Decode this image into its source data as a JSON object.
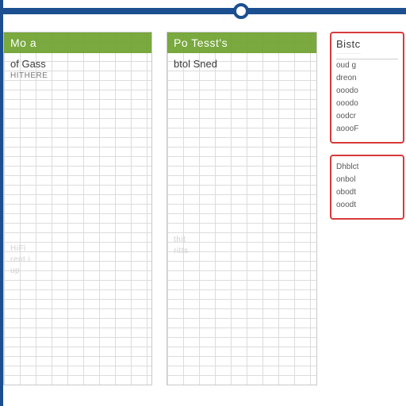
{
  "colors": {
    "bar": "#1b4f90",
    "header": "#6fa22f",
    "panel_border": "#d83a3a"
  },
  "columns": {
    "left": {
      "title": "Mo  a",
      "subtitle": "of Gass",
      "meta": "HITHERE",
      "faint": [
        "HiFi",
        "rent i",
        "up"
      ]
    },
    "mid": {
      "title": "Po  Tesst's",
      "subtitle": "btol Sned",
      "meta": "",
      "faint": [
        "thit",
        "",
        "ritts"
      ]
    }
  },
  "panels": {
    "top": {
      "title": "Bistc",
      "items": [
        "oud g",
        "dreon",
        "ooodo",
        "ooodo",
        "oodcr",
        "aoooF"
      ]
    },
    "bottom": {
      "title": "",
      "items": [
        "Dhblct",
        "onbol",
        "obodt",
        "ooodt"
      ]
    }
  }
}
